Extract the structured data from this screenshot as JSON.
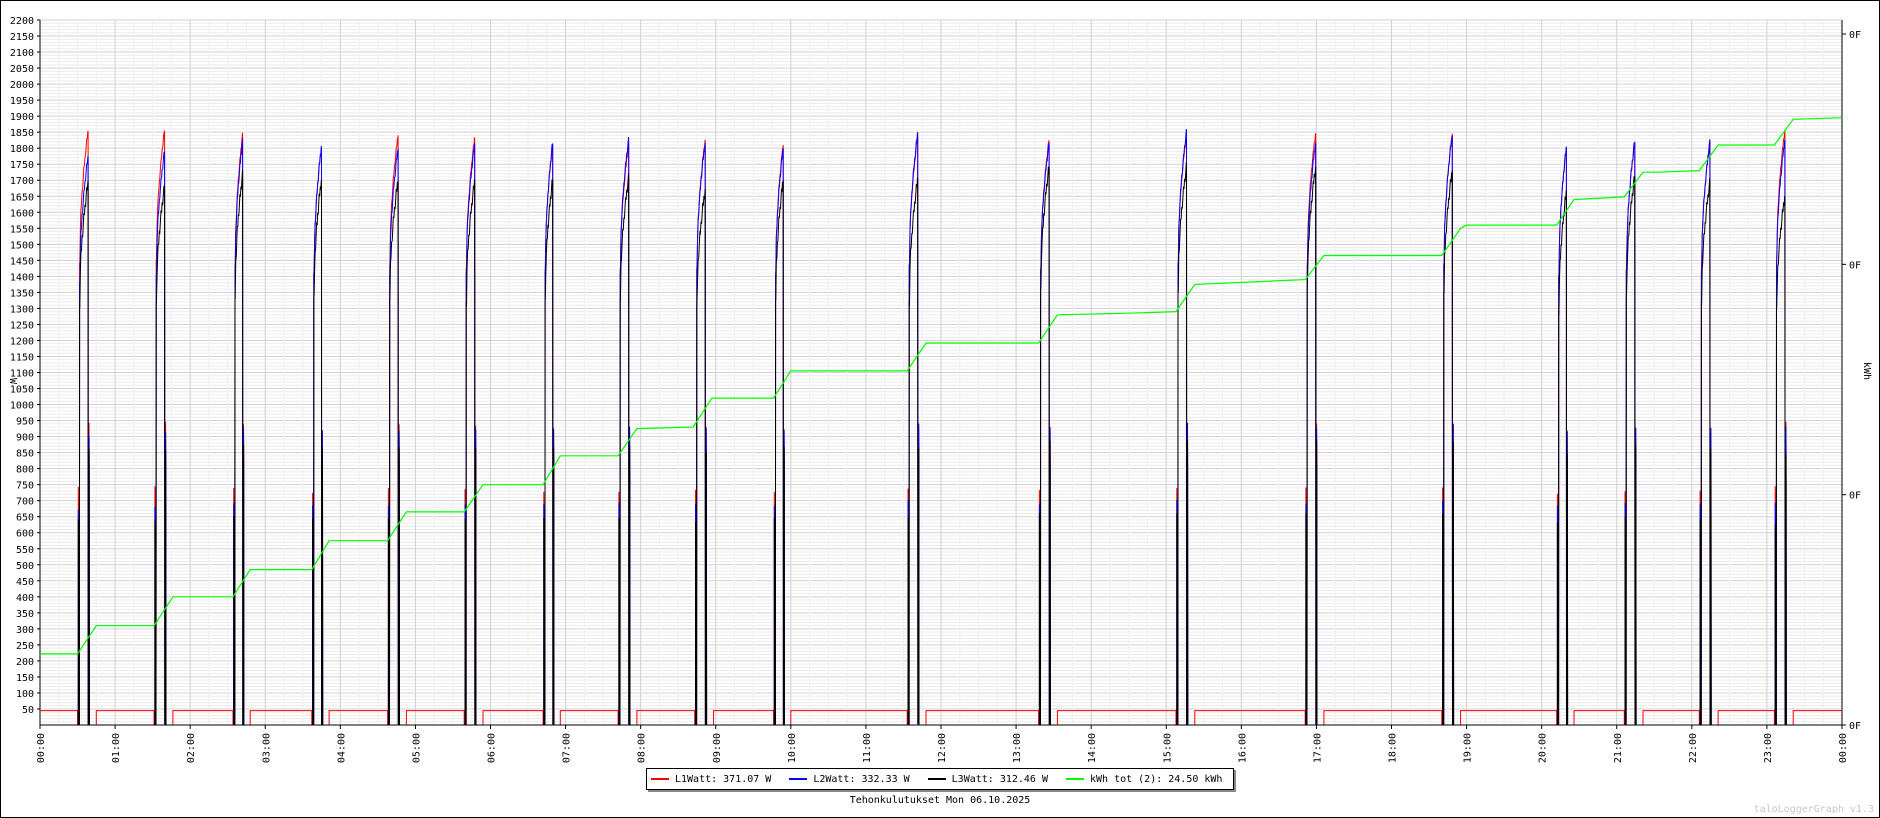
{
  "chart_data": {
    "type": "line",
    "caption": "Tehonkulutukset Mon 06.10.2025",
    "watermark": "taloLoggerGraph v1.3",
    "ylabel_left": "W",
    "ylabel_right": "kWh",
    "ylim": [
      0,
      2200
    ],
    "yticks": [
      50,
      100,
      150,
      200,
      250,
      300,
      350,
      400,
      450,
      500,
      550,
      600,
      650,
      700,
      750,
      800,
      850,
      900,
      950,
      1000,
      1050,
      1100,
      1150,
      1200,
      1250,
      1300,
      1350,
      1400,
      1450,
      1500,
      1550,
      1600,
      1650,
      1700,
      1750,
      1800,
      1850,
      1900,
      1950,
      2000,
      2050,
      2100,
      2150,
      2200
    ],
    "right_ticks": [
      "0F",
      "0F",
      "0F",
      "0F"
    ],
    "xlabels": [
      "00:00",
      "01:00",
      "02:00",
      "03:00",
      "04:00",
      "05:00",
      "06:00",
      "07:00",
      "08:00",
      "09:00",
      "10:00",
      "11:00",
      "12:00",
      "13:00",
      "14:00",
      "15:00",
      "16:00",
      "17:00",
      "18:00",
      "19:00",
      "20:00",
      "21:00",
      "22:00",
      "23:00",
      "00:00"
    ],
    "grid": true,
    "legend": [
      {
        "label": "L1Watt: 371.07 W",
        "color": "#ff0000"
      },
      {
        "label": "L2Watt: 332.33 W",
        "color": "#0000ff"
      },
      {
        "label": "L3Watt: 312.46 W",
        "color": "#000000"
      },
      {
        "label": "kWh tot (2): 24.50 kWh",
        "color": "#00ff00"
      }
    ],
    "pulses": [
      {
        "start": 0.5,
        "end": 0.75,
        "l1": 1850,
        "l2": 1770,
        "l3": 1690
      },
      {
        "start": 1.52,
        "end": 1.77,
        "l1": 1855,
        "l2": 1790,
        "l3": 1680
      },
      {
        "start": 2.57,
        "end": 2.8,
        "l1": 1840,
        "l2": 1820,
        "l3": 1715
      },
      {
        "start": 3.62,
        "end": 3.85,
        "l1": 1800,
        "l2": 1805,
        "l3": 1700
      },
      {
        "start": 4.63,
        "end": 4.88,
        "l1": 1840,
        "l2": 1800,
        "l3": 1700
      },
      {
        "start": 5.65,
        "end": 5.9,
        "l1": 1830,
        "l2": 1810,
        "l3": 1695
      },
      {
        "start": 6.7,
        "end": 6.93,
        "l1": 1810,
        "l2": 1815,
        "l3": 1700
      },
      {
        "start": 7.7,
        "end": 7.95,
        "l1": 1810,
        "l2": 1825,
        "l3": 1705
      },
      {
        "start": 8.72,
        "end": 8.97,
        "l1": 1825,
        "l2": 1815,
        "l3": 1670
      },
      {
        "start": 9.77,
        "end": 10.0,
        "l1": 1810,
        "l2": 1800,
        "l3": 1700
      },
      {
        "start": 11.55,
        "end": 11.8,
        "l1": 1835,
        "l2": 1845,
        "l3": 1700
      },
      {
        "start": 13.3,
        "end": 13.55,
        "l1": 1825,
        "l2": 1815,
        "l3": 1740
      },
      {
        "start": 15.13,
        "end": 15.38,
        "l1": 1840,
        "l2": 1850,
        "l3": 1740
      },
      {
        "start": 16.85,
        "end": 17.1,
        "l1": 1845,
        "l2": 1815,
        "l3": 1740
      },
      {
        "start": 18.67,
        "end": 18.92,
        "l1": 1845,
        "l2": 1840,
        "l3": 1730
      },
      {
        "start": 20.2,
        "end": 20.43,
        "l1": 1795,
        "l2": 1800,
        "l3": 1660
      },
      {
        "start": 21.1,
        "end": 21.35,
        "l1": 1815,
        "l2": 1820,
        "l3": 1710
      },
      {
        "start": 22.1,
        "end": 22.35,
        "l1": 1820,
        "l2": 1815,
        "l3": 1690
      },
      {
        "start": 23.1,
        "end": 23.35,
        "l1": 1855,
        "l2": 1825,
        "l3": 1650
      }
    ],
    "baseline_l1": 45,
    "kwh_tot_series": {
      "x": [
        0.0,
        0.5,
        0.75,
        1.52,
        1.77,
        2.57,
        2.8,
        3.62,
        3.85,
        4.63,
        4.88,
        5.65,
        5.9,
        6.7,
        6.93,
        7.7,
        7.95,
        8.7,
        8.95,
        9.77,
        10.0,
        11.55,
        11.8,
        13.3,
        13.55,
        14.5,
        15.13,
        15.38,
        16.85,
        17.1,
        18.67,
        18.92,
        19.0,
        20.2,
        20.43,
        21.1,
        21.35,
        21.55,
        22.1,
        22.35,
        23.1,
        23.35,
        24.0
      ],
      "y": [
        222,
        222,
        310,
        310,
        400,
        400,
        485,
        485,
        575,
        575,
        665,
        665,
        750,
        750,
        840,
        840,
        925,
        930,
        1020,
        1020,
        1105,
        1105,
        1192,
        1192,
        1280,
        1285,
        1290,
        1375,
        1390,
        1465,
        1465,
        1550,
        1560,
        1560,
        1640,
        1648,
        1725,
        1725,
        1730,
        1810,
        1810,
        1890,
        1895
      ]
    }
  }
}
